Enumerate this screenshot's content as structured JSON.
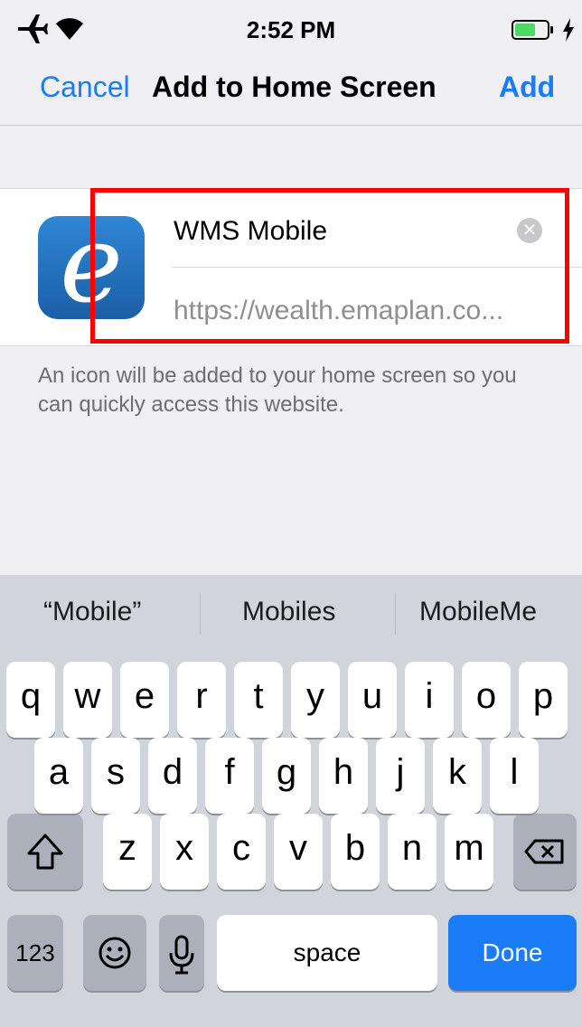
{
  "status_bar": {
    "time": "2:52 PM"
  },
  "nav": {
    "cancel": "Cancel",
    "title": "Add to Home Screen",
    "add": "Add"
  },
  "card": {
    "icon_letter": "e",
    "name_value": "WMS Mobile",
    "url": "https://wealth.emaplan.co..."
  },
  "description": "An icon will be added to your home screen so you can quickly access this website.",
  "keyboard": {
    "suggestions": [
      "“Mobile”",
      "Mobiles",
      "MobileMe"
    ],
    "row1": [
      "q",
      "w",
      "e",
      "r",
      "t",
      "y",
      "u",
      "i",
      "o",
      "p"
    ],
    "row2": [
      "a",
      "s",
      "d",
      "f",
      "g",
      "h",
      "j",
      "k",
      "l"
    ],
    "row3": [
      "z",
      "x",
      "c",
      "v",
      "b",
      "n",
      "m"
    ],
    "numbers": "123",
    "space": "space",
    "done": "Done"
  },
  "colors": {
    "accent": "#1a7cf6",
    "highlight": "#ff0000"
  }
}
